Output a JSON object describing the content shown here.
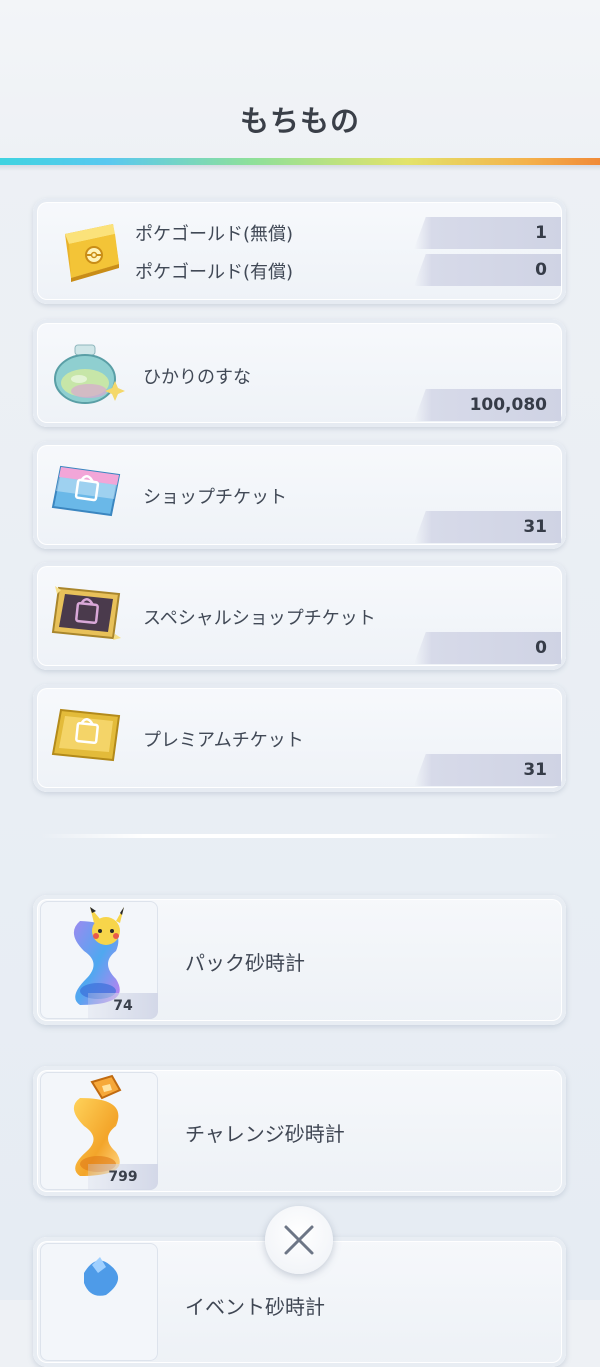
{
  "header": {
    "title": "もちもの"
  },
  "items": {
    "pokegold": {
      "icon": "gold-bar-icon",
      "free_label": "ポケゴールド(無償)",
      "free_value": "1",
      "paid_label": "ポケゴールド(有償)",
      "paid_value": "0"
    },
    "shine_dust": {
      "icon": "shine-dust-bottle-icon",
      "label": "ひかりのすな",
      "value": "100,080"
    },
    "shop_ticket": {
      "icon": "shop-ticket-icon",
      "label": "ショップチケット",
      "value": "31"
    },
    "special_shop_ticket": {
      "icon": "special-shop-ticket-icon",
      "label": "スペシャルショップチケット",
      "value": "0"
    },
    "premium_ticket": {
      "icon": "premium-ticket-icon",
      "label": "プレミアムチケット",
      "value": "31"
    }
  },
  "hourglasses": [
    {
      "icon": "pack-hourglass-icon",
      "label": "パック砂時計",
      "count": "74"
    },
    {
      "icon": "challenge-hourglass-icon",
      "label": "チャレンジ砂時計",
      "count": "799"
    },
    {
      "icon": "event-hourglass-icon",
      "label": "イベント砂時計"
    }
  ],
  "colors": {
    "rainbow": [
      "#3fd3e0",
      "#8ee09a",
      "#e3e36a",
      "#f08a38"
    ],
    "value_bar": "#cfd3e4",
    "gold": "#f0c437"
  },
  "close_button": {
    "icon": "close-icon"
  }
}
